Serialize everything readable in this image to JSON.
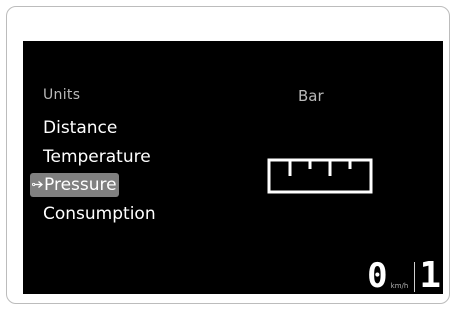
{
  "menu": {
    "header": "Units",
    "items": [
      {
        "label": "Distance",
        "selected": false
      },
      {
        "label": "Temperature",
        "selected": false
      },
      {
        "label": "Pressure",
        "selected": true
      },
      {
        "label": "Consumption",
        "selected": false
      }
    ],
    "selection_pointer": "→"
  },
  "detail": {
    "value_label": "Bar",
    "icon": "pressure-scale-icon"
  },
  "status_bar": {
    "speed": "0",
    "speed_unit": "km/h",
    "gear": "1"
  },
  "colors": {
    "screen_background": "#000000",
    "text_primary": "#ffffff",
    "text_secondary": "#b9b9b9",
    "selection_highlight": "#808080"
  }
}
